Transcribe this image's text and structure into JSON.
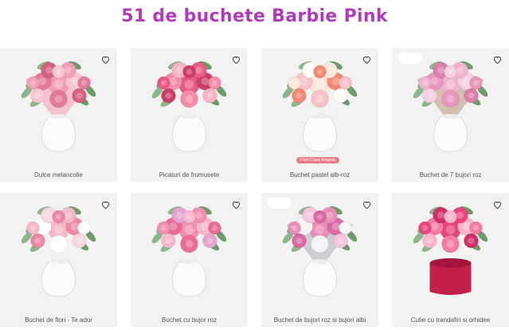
{
  "page": {
    "title": "51 de buchete Barbie Pink"
  },
  "products": [
    {
      "name": "Dulce melancolie",
      "palette": [
        "#f29fb6",
        "#e27a99",
        "#f7c6d3",
        "#d5617f"
      ],
      "wrap": "#f5b8c8",
      "vase": "jar",
      "badge": null,
      "blurred_badge": false
    },
    {
      "name": "Picaturi de frumusete",
      "palette": [
        "#e85a86",
        "#f38ca6",
        "#c93f6a",
        "#f6b3c5"
      ],
      "wrap": null,
      "vase": "jar",
      "badge": null,
      "blurred_badge": false
    },
    {
      "name": "Buchet pastel alb-roz",
      "palette": [
        "#fbe7d8",
        "#f6c1c7",
        "#f08a74",
        "#fdfdf5"
      ],
      "wrap": null,
      "vase": "jar",
      "badge": "Flori Casa Regala",
      "blurred_badge": false
    },
    {
      "name": "Buchet de 7 bujori roz",
      "palette": [
        "#f0b3cf",
        "#e996bb",
        "#f6cfe0",
        "#d97fa8"
      ],
      "wrap": "#cdb8a6",
      "vase": "jar",
      "badge": null,
      "blurred_badge": true
    },
    {
      "name": "Buchet de flori - Te ador",
      "palette": [
        "#f4b7c8",
        "#ffffff",
        "#e88aa5",
        "#f8d7e0"
      ],
      "wrap": null,
      "vase": "jar",
      "badge": null,
      "blurred_badge": false
    },
    {
      "name": "Buchet cu bujor roz",
      "palette": [
        "#f08fb1",
        "#ea6c96",
        "#f6b6cc",
        "#e4a4d0"
      ],
      "wrap": null,
      "vase": "jar",
      "badge": null,
      "blurred_badge": false
    },
    {
      "name": "Buchet de bujori roz si bujori albi",
      "palette": [
        "#e88cb8",
        "#f6f3f6",
        "#d96aa3",
        "#f3c5db"
      ],
      "wrap": "#c9c6cc",
      "vase": "jar",
      "badge": null,
      "blurred_badge": true
    },
    {
      "name": "Cutie cu trandafiri si orhidee",
      "palette": [
        "#e8457e",
        "#f37ba4",
        "#f8b5c9",
        "#d22f6a"
      ],
      "wrap": null,
      "vase": "box",
      "badge": null,
      "blurred_badge": false
    }
  ],
  "icons": {
    "favorite": "heart-outline-icon"
  },
  "colors": {
    "title": "#b03bb8",
    "card_bg": "#f2f2f2",
    "badge_bg": "#e87a88"
  }
}
